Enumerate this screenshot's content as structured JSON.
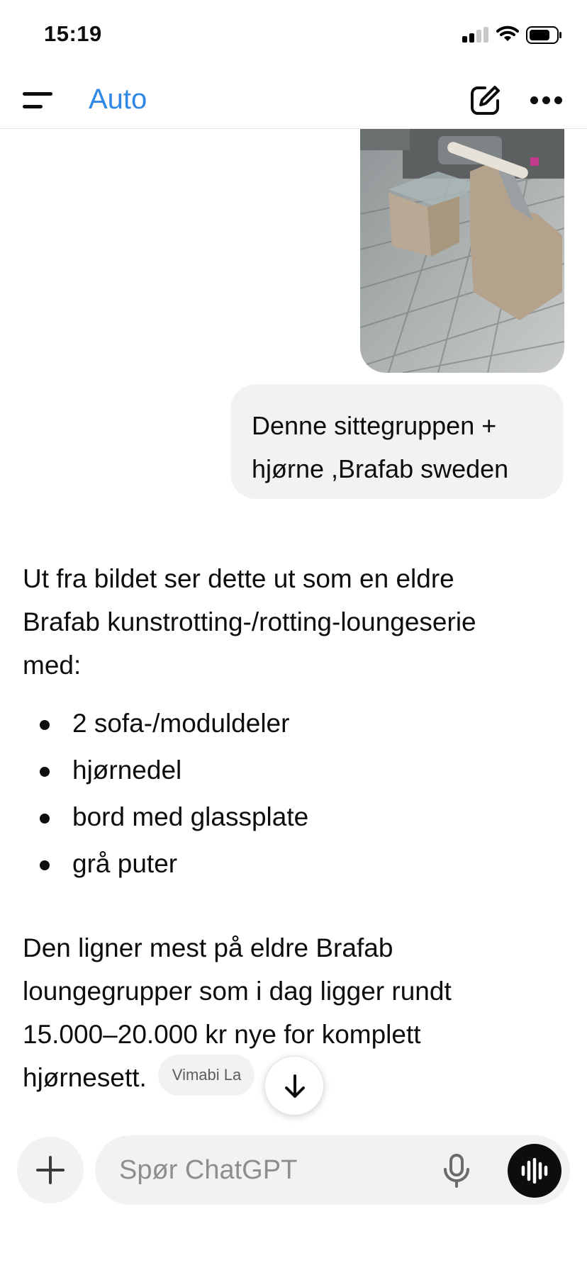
{
  "status_bar": {
    "time": "15:19"
  },
  "header": {
    "model_label": "Auto",
    "menu_icon": "menu-icon",
    "edit_icon": "new-chat-icon",
    "more_icon": "more-icon"
  },
  "user_message": {
    "image_alt": "rattan lounge furniture on deck",
    "lines": [
      "Denne sittegruppen +",
      "hjørne ,Brafab sweden"
    ]
  },
  "assistant": {
    "intro_lines": [
      "Ut fra bildet ser dette ut som en eldre",
      "Brafab kunstrotting-/rotting-loungeserie",
      "med:"
    ],
    "bullets": [
      "2 sofa-/moduldeler",
      "hjørnedel",
      "bord med glassplate",
      "grå puter"
    ],
    "outro_lines": [
      "Den ligner mest på eldre Brafab",
      "loungegrupper som i dag ligger rundt",
      "15.000–20.000 kr nye for komplett",
      "hjørnesett."
    ],
    "source_chip": "Vimabi La"
  },
  "composer": {
    "placeholder": "Spør ChatGPT"
  },
  "colors": {
    "accent": "#2f87e6",
    "bubble": "#f2f2f2",
    "text": "#0d0d0d"
  }
}
